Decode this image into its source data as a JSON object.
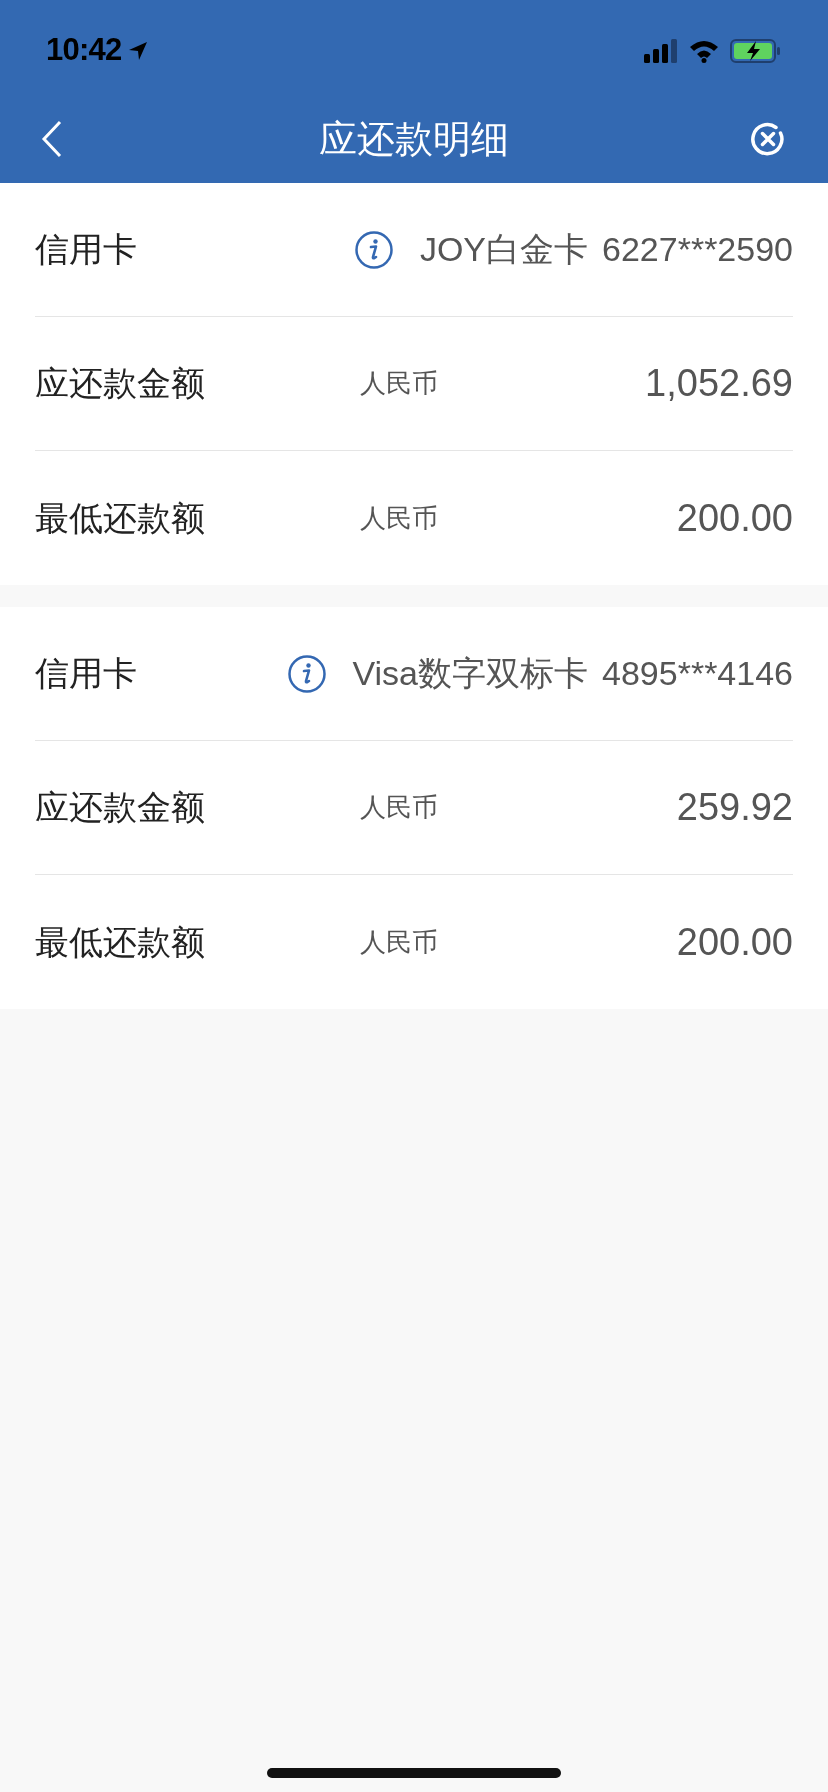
{
  "status_bar": {
    "time": "10:42"
  },
  "nav": {
    "title": "应还款明细"
  },
  "cards": [
    {
      "card_label": "信用卡",
      "card_name": "JOY白金卡",
      "card_number": "6227***2590",
      "rows": [
        {
          "label": "应还款金额",
          "currency": "人民币",
          "amount": "1,052.69"
        },
        {
          "label": "最低还款额",
          "currency": "人民币",
          "amount": "200.00"
        }
      ]
    },
    {
      "card_label": "信用卡",
      "card_name": "Visa数字双标卡",
      "card_number": "4895***4146",
      "rows": [
        {
          "label": "应还款金额",
          "currency": "人民币",
          "amount": "259.92"
        },
        {
          "label": "最低还款额",
          "currency": "人民币",
          "amount": "200.00"
        }
      ]
    }
  ]
}
